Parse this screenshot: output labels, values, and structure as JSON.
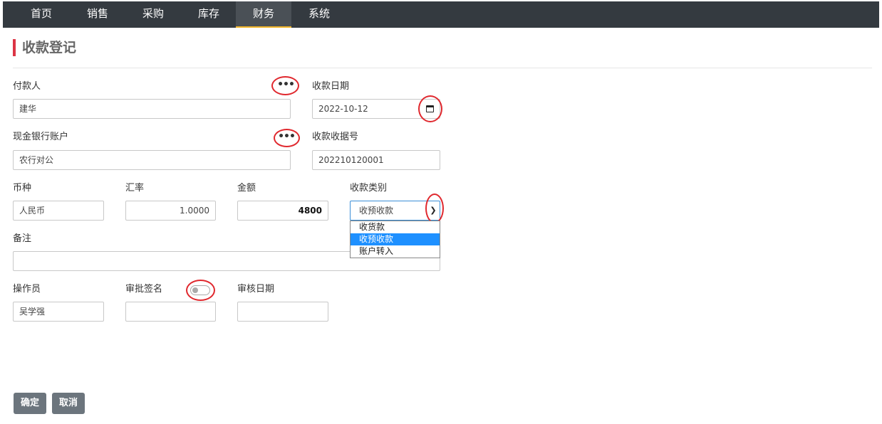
{
  "nav": {
    "items": [
      "首页",
      "销售",
      "采购",
      "库存",
      "财务",
      "系统"
    ],
    "active_index": 4
  },
  "page": {
    "title": "收款登记"
  },
  "form": {
    "payer": {
      "label": "付款人",
      "value": "建华"
    },
    "receipt_date": {
      "label": "收款日期",
      "value": "2022-10-12"
    },
    "bank_account": {
      "label": "现金银行账户",
      "value": "农行对公"
    },
    "receipt_no": {
      "label": "收款收据号",
      "value": "202210120001"
    },
    "currency": {
      "label": "币种",
      "value": "人民币"
    },
    "rate": {
      "label": "汇率",
      "value": "1.0000"
    },
    "amount": {
      "label": "金额",
      "value": "4800"
    },
    "category": {
      "label": "收款类别",
      "value": "收预收款",
      "options": [
        "收货款",
        "收预收款",
        "账户转入"
      ],
      "selected_index": 1
    },
    "note": {
      "label": "备注",
      "value": ""
    },
    "operator": {
      "label": "操作员",
      "value": "吴学强"
    },
    "approval": {
      "label": "审批签名",
      "value": ""
    },
    "review_date": {
      "label": "审核日期",
      "value": ""
    }
  },
  "buttons": {
    "ok": "确定",
    "cancel": "取消"
  },
  "icons": {
    "more": "ellipsis-icon",
    "calendar": "calendar-icon",
    "dropdown": "chevron-down-icon"
  },
  "colors": {
    "nav_bg": "#343a40",
    "nav_active_underline": "#f0b429",
    "title_accent": "#dc3545",
    "annotation": "#e0282e",
    "selection": "#1e90ff"
  }
}
